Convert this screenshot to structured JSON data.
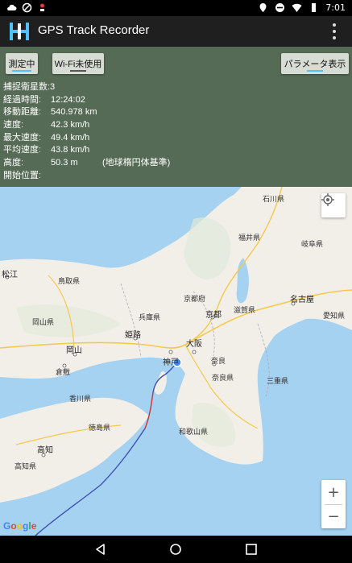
{
  "statusbar": {
    "time": "7:01"
  },
  "app": {
    "title": "GPS Track Recorder"
  },
  "toolbar": {
    "measuring_label": "測定中",
    "wifi_label": "Wi-Fi未使用",
    "params_label": "パラメータ表示"
  },
  "info": {
    "satellites": "捕捉衛星数:3",
    "elapsed_label": "経過時間:",
    "elapsed_value": "12:24:02",
    "distance_label": "移動距離:",
    "distance_value": "540.978 km",
    "speed_label": "速度:",
    "speed_value": "42.3 km/h",
    "max_speed_label": "最大速度:",
    "max_speed_value": "49.4 km/h",
    "avg_speed_label": "平均速度:",
    "avg_speed_value": "43.8 km/h",
    "altitude_label": "高度:",
    "altitude_value": "50.3 m",
    "altitude_note": "(地球楕円体基準)",
    "start_label": "開始位置:"
  },
  "map": {
    "labels": {
      "matsue": "松江",
      "tottori": "鳥取県",
      "okayama_pref": "岡山県",
      "hyogo": "兵庫県",
      "kyoto_pref": "京都府",
      "kyoto": "京都",
      "osaka": "大阪",
      "kobe": "神戸",
      "himeji": "姫路",
      "okayama": "岡山",
      "kurashiki": "倉敷",
      "nara": "奈良",
      "nara_pref": "奈良県",
      "wakayama": "和歌山県",
      "shiga": "滋賀県",
      "mie": "三重県",
      "fukui": "福井県",
      "ishikawa": "石川県",
      "gifu": "岐阜県",
      "nagoya": "名古屋",
      "aichi": "愛知県",
      "kagawa": "香川県",
      "tokushima": "徳島県",
      "kochi": "高知",
      "kochi_pref": "高知県"
    },
    "attribution": "Google"
  },
  "colors": {
    "panel": "#566b55",
    "track": "#3f51b5",
    "track_fast": "#d32f2f",
    "accent": "#4fc3f7"
  }
}
